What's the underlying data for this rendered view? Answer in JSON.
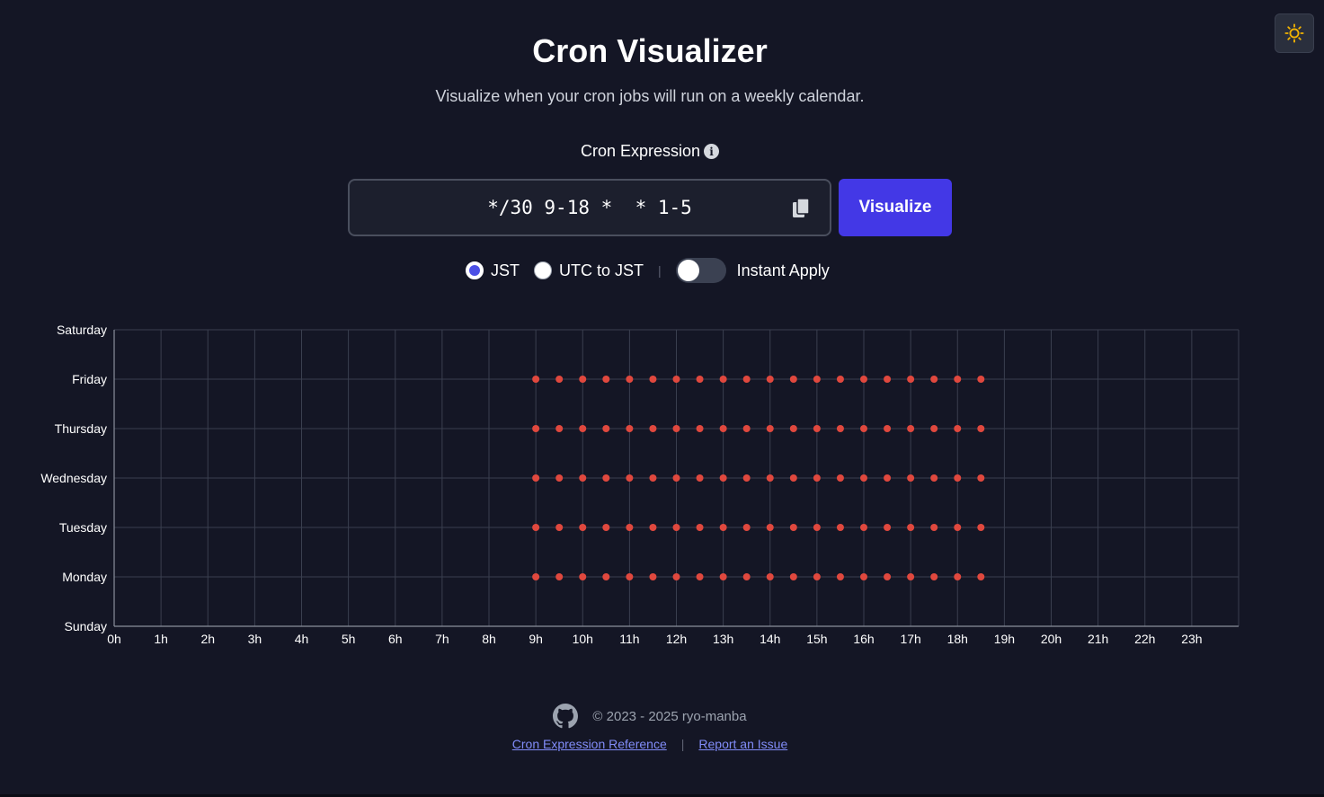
{
  "header": {
    "title": "Cron Visualizer",
    "subtitle": "Visualize when your cron jobs will run on a weekly calendar."
  },
  "form": {
    "label": "Cron Expression",
    "cron_value": "*/30 9-18 *  * 1-5",
    "visualize_label": "Visualize",
    "timezone_options": [
      "JST",
      "UTC to JST"
    ],
    "selected_timezone": "JST",
    "instant_apply_label": "Instant Apply",
    "instant_apply_on": false
  },
  "chart_data": {
    "type": "scatter",
    "x_tick_labels": [
      "0h",
      "1h",
      "2h",
      "3h",
      "4h",
      "5h",
      "6h",
      "7h",
      "8h",
      "9h",
      "10h",
      "11h",
      "12h",
      "13h",
      "14h",
      "15h",
      "16h",
      "17h",
      "18h",
      "19h",
      "20h",
      "21h",
      "22h",
      "23h"
    ],
    "xlim": [
      0,
      24
    ],
    "y_categories": [
      "Sunday",
      "Monday",
      "Tuesday",
      "Wednesday",
      "Thursday",
      "Friday",
      "Saturday"
    ],
    "grid": true,
    "point_color": "#e0483e",
    "points": [
      {
        "day": "Monday",
        "hours": [
          9,
          9.5,
          10,
          10.5,
          11,
          11.5,
          12,
          12.5,
          13,
          13.5,
          14,
          14.5,
          15,
          15.5,
          16,
          16.5,
          17,
          17.5,
          18,
          18.5
        ]
      },
      {
        "day": "Tuesday",
        "hours": [
          9,
          9.5,
          10,
          10.5,
          11,
          11.5,
          12,
          12.5,
          13,
          13.5,
          14,
          14.5,
          15,
          15.5,
          16,
          16.5,
          17,
          17.5,
          18,
          18.5
        ]
      },
      {
        "day": "Wednesday",
        "hours": [
          9,
          9.5,
          10,
          10.5,
          11,
          11.5,
          12,
          12.5,
          13,
          13.5,
          14,
          14.5,
          15,
          15.5,
          16,
          16.5,
          17,
          17.5,
          18,
          18.5
        ]
      },
      {
        "day": "Thursday",
        "hours": [
          9,
          9.5,
          10,
          10.5,
          11,
          11.5,
          12,
          12.5,
          13,
          13.5,
          14,
          14.5,
          15,
          15.5,
          16,
          16.5,
          17,
          17.5,
          18,
          18.5
        ]
      },
      {
        "day": "Friday",
        "hours": [
          9,
          9.5,
          10,
          10.5,
          11,
          11.5,
          12,
          12.5,
          13,
          13.5,
          14,
          14.5,
          15,
          15.5,
          16,
          16.5,
          17,
          17.5,
          18,
          18.5
        ]
      }
    ]
  },
  "footer": {
    "copyright": "© 2023 - 2025 ryo-manba",
    "links": [
      "Cron Expression Reference",
      "Report an Issue"
    ]
  },
  "icons": {
    "theme": "sun-icon",
    "info": "info-icon",
    "copy": "copy-icon",
    "github": "github-icon"
  },
  "colors": {
    "background": "#141625",
    "accent": "#4338e6",
    "link": "#818cf8"
  }
}
